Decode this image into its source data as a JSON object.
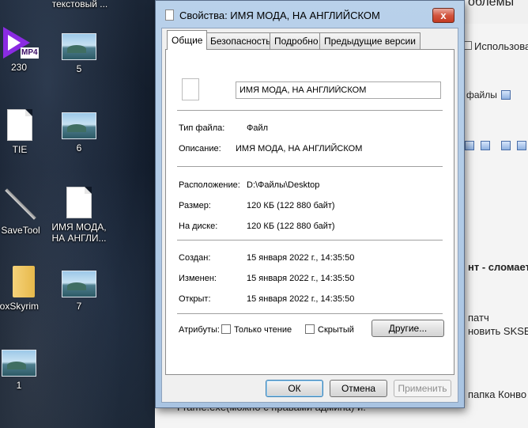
{
  "desktop": {
    "icons": [
      {
        "label": "текстовый ..."
      },
      {
        "label": "230",
        "badge": "MP4"
      },
      {
        "label": "5"
      },
      {
        "label": "TIE"
      },
      {
        "label": "6"
      },
      {
        "label": "SaveTool"
      },
      {
        "label": "ИМЯ МОДА, НА АНГЛИ..."
      },
      {
        "label": "xboxSkyrim"
      },
      {
        "label": "7"
      },
      {
        "label": "1"
      }
    ]
  },
  "background_window": {
    "heading_fragment": "облемы",
    "checkbox_label": "Использоват",
    "files_label": "файлы",
    "text_fragments": [
      "нт - сломает",
      "патч",
      "новить SKSE",
      "папка Конво",
      "Frame.exe(можно с правами админа) и."
    ]
  },
  "dialog": {
    "title": "Свойства: ИМЯ МОДА, НА АНГЛИЙСКОМ",
    "close_glyph": "x",
    "tabs": [
      "Общие",
      "Безопасность",
      "Подробно",
      "Предыдущие версии"
    ],
    "file_name": "ИМЯ МОДА, НА АНГЛИЙСКОМ",
    "type_label": "Тип файла:",
    "type_value": "Файл",
    "desc_label": "Описание:",
    "desc_value": "ИМЯ МОДА, НА АНГЛИЙСКОМ",
    "location_label": "Расположение:",
    "location_value": "D:\\Файлы\\Desktop",
    "size_label": "Размер:",
    "size_value": "120 КБ (122 880 байт)",
    "ondisk_label": "На диске:",
    "ondisk_value": "120 КБ (122 880 байт)",
    "created_label": "Создан:",
    "created_value": "15 января 2022 г., 14:35:50",
    "modified_label": "Изменен:",
    "modified_value": "15 января 2022 г., 14:35:50",
    "opened_label": "Открыт:",
    "opened_value": "15 января 2022 г., 14:35:50",
    "attributes_label": "Атрибуты:",
    "readonly_label": "Только чтение",
    "hidden_label": "Скрытый",
    "other_button": "Другие...",
    "ok_button": "ОК",
    "cancel_button": "Отмена",
    "apply_button": "Применить"
  }
}
